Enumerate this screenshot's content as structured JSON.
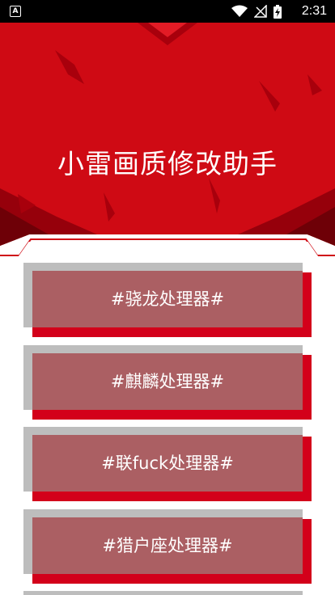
{
  "status_bar": {
    "time": "2:31",
    "icons": [
      "android-a-icon",
      "wifi-icon",
      "no-signal-icon",
      "battery-charging-icon"
    ]
  },
  "app": {
    "title": "小雷画质修改助手"
  },
  "colors": {
    "accent_red": "#d3001a",
    "card_face": "#ab5f63",
    "card_shadow": "#bdbdbd"
  },
  "menu": {
    "items": [
      {
        "label": "#骁龙处理器#"
      },
      {
        "label": "#麒麟处理器#"
      },
      {
        "label": "#联fuck处理器#"
      },
      {
        "label": "#猎户座处理器#"
      }
    ]
  }
}
